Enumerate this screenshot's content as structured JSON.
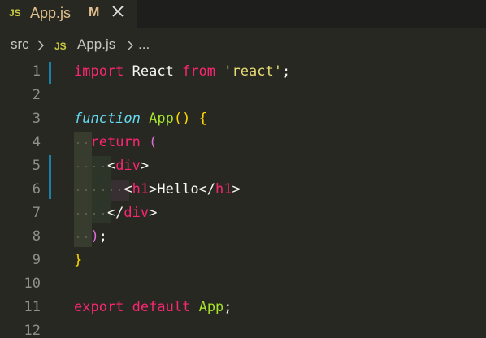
{
  "tab": {
    "badge": "JS",
    "title": "App.js",
    "modified": "M",
    "close_icon": "close-icon"
  },
  "breadcrumb": {
    "folder": "src",
    "badge": "JS",
    "file": "App.js",
    "more": "..."
  },
  "editor": {
    "lines": [
      {
        "number": "1",
        "tokens": [
          {
            "t": "import",
            "c": "kw-pink"
          },
          {
            "t": " React ",
            "c": "plain"
          },
          {
            "t": "from",
            "c": "kw-pink"
          },
          {
            "t": " ",
            "c": "plain"
          },
          {
            "t": "'react'",
            "c": "str-yellow"
          },
          {
            "t": ";",
            "c": "plain"
          }
        ]
      },
      {
        "number": "2",
        "tokens": []
      },
      {
        "number": "3",
        "tokens": [
          {
            "t": "function",
            "c": "kw-italic"
          },
          {
            "t": " ",
            "c": "plain"
          },
          {
            "t": "App",
            "c": "fn-green"
          },
          {
            "t": "()",
            "c": "bracket-gold"
          },
          {
            "t": " ",
            "c": "plain"
          },
          {
            "t": "{",
            "c": "bracket-gold"
          }
        ]
      },
      {
        "number": "4",
        "tokens": [
          {
            "t": "  ",
            "c": "plain"
          },
          {
            "t": "return",
            "c": "kw-pink"
          },
          {
            "t": " ",
            "c": "plain"
          },
          {
            "t": "(",
            "c": "bracket-violet"
          }
        ]
      },
      {
        "number": "5",
        "tokens": [
          {
            "t": "    <",
            "c": "plain"
          },
          {
            "t": "div",
            "c": "tag-pink"
          },
          {
            "t": ">",
            "c": "plain"
          }
        ]
      },
      {
        "number": "6",
        "tokens": [
          {
            "t": "      <",
            "c": "plain"
          },
          {
            "t": "h1",
            "c": "tag-pink"
          },
          {
            "t": ">Hello</",
            "c": "plain"
          },
          {
            "t": "h1",
            "c": "tag-pink"
          },
          {
            "t": ">",
            "c": "plain"
          }
        ]
      },
      {
        "number": "7",
        "tokens": [
          {
            "t": "    </",
            "c": "plain"
          },
          {
            "t": "div",
            "c": "tag-pink"
          },
          {
            "t": ">",
            "c": "plain"
          }
        ]
      },
      {
        "number": "8",
        "tokens": [
          {
            "t": "  ",
            "c": "plain"
          },
          {
            "t": ")",
            "c": "bracket-violet"
          },
          {
            "t": ";",
            "c": "plain"
          }
        ]
      },
      {
        "number": "9",
        "tokens": [
          {
            "t": "}",
            "c": "bracket-gold"
          }
        ]
      },
      {
        "number": "10",
        "tokens": []
      },
      {
        "number": "11",
        "tokens": [
          {
            "t": "export",
            "c": "kw-pink"
          },
          {
            "t": " ",
            "c": "plain"
          },
          {
            "t": "default",
            "c": "kw-pink"
          },
          {
            "t": " ",
            "c": "plain"
          },
          {
            "t": "App",
            "c": "fn-green"
          },
          {
            "t": ";",
            "c": "plain"
          }
        ]
      },
      {
        "number": "12",
        "tokens": []
      }
    ]
  },
  "colors": {
    "background": "#272822",
    "tabbar_background": "#1e1f1c",
    "modified_text": "#e2c08d",
    "js_badge": "#cbcb41",
    "gutter_change": "#1b81a8",
    "keyword": "#f92672",
    "function": "#a6e22e",
    "string": "#e6db74",
    "storage": "#66d9ef",
    "line_number": "#90908a"
  }
}
